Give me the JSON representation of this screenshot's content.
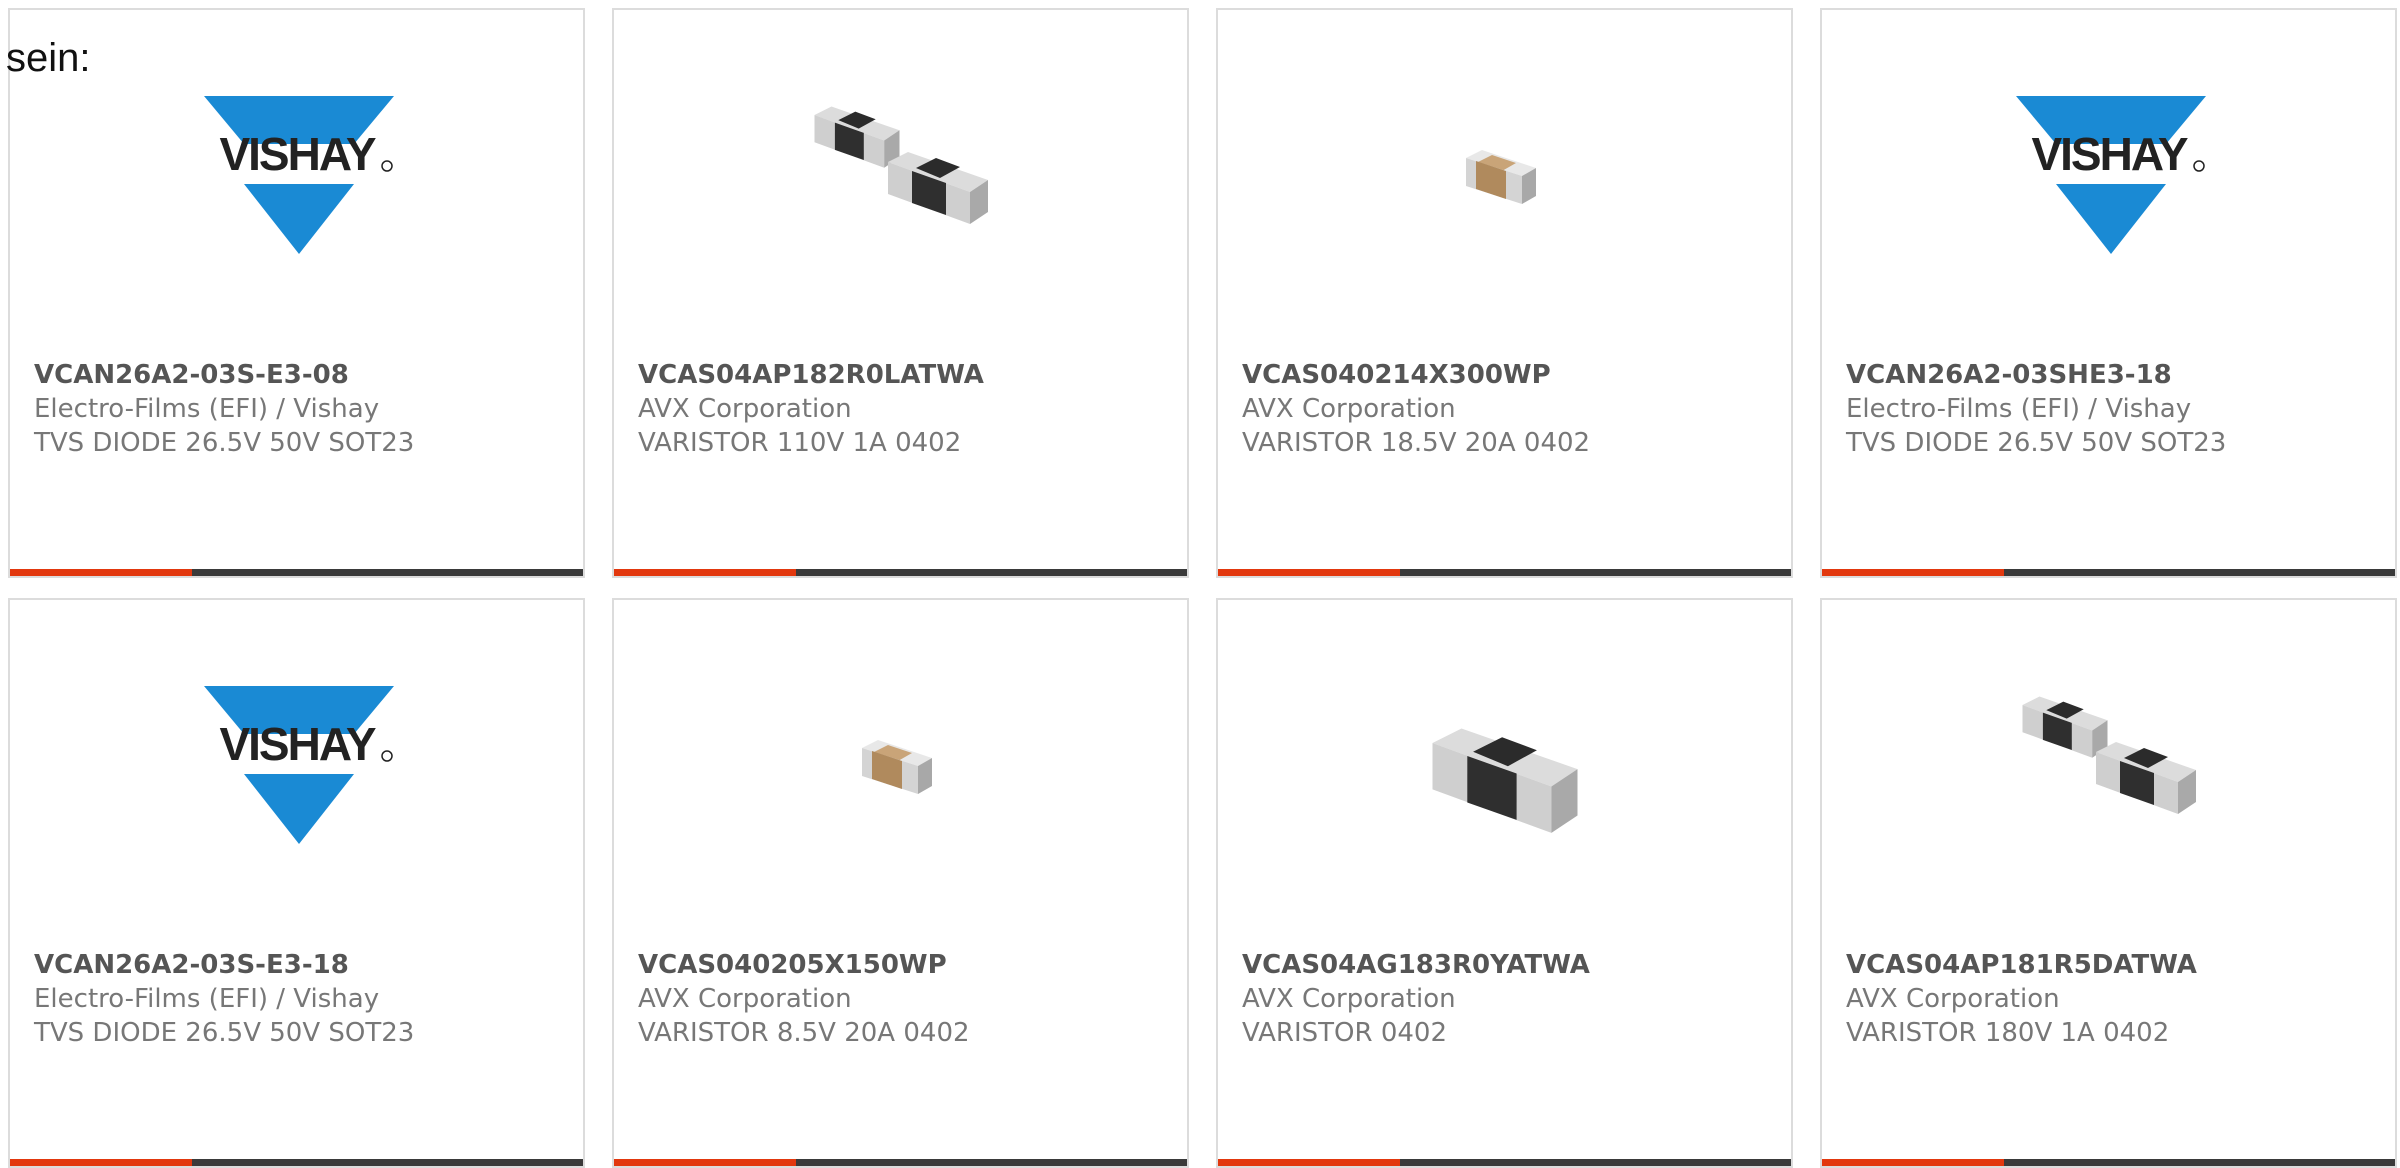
{
  "intro_text": "sein:",
  "colors": {
    "accent": "#e2380e",
    "bar": "#3a3a3a",
    "vishay_blue": "#1a8ad4"
  },
  "products": [
    {
      "part_number": "VCAN26A2-03S-E3-08",
      "manufacturer": "Electro-Films (EFI) / Vishay",
      "description": "TVS DIODE 26.5V 50V SOT23",
      "image": "vishay-logo"
    },
    {
      "part_number": "VCAS04AP182R0LATWA",
      "manufacturer": "AVX Corporation",
      "description": "VARISTOR 110V 1A 0402",
      "image": "two-dark-chip-components"
    },
    {
      "part_number": "VCAS040214X300WP",
      "manufacturer": "AVX Corporation",
      "description": "VARISTOR 18.5V 20A 0402",
      "image": "small-tan-chip-component"
    },
    {
      "part_number": "VCAN26A2-03SHE3-18",
      "manufacturer": "Electro-Films (EFI) / Vishay",
      "description": "TVS DIODE 26.5V 50V SOT23",
      "image": "vishay-logo"
    },
    {
      "part_number": "VCAN26A2-03S-E3-18",
      "manufacturer": "Electro-Films (EFI) / Vishay",
      "description": "TVS DIODE 26.5V 50V SOT23",
      "image": "vishay-logo"
    },
    {
      "part_number": "VCAS040205X150WP",
      "manufacturer": "AVX Corporation",
      "description": "VARISTOR 8.5V 20A 0402",
      "image": "small-tan-chip-component"
    },
    {
      "part_number": "VCAS04AG183R0YATWA",
      "manufacturer": "AVX Corporation",
      "description": "VARISTOR 0402",
      "image": "large-dark-chip-component"
    },
    {
      "part_number": "VCAS04AP181R5DATWA",
      "manufacturer": "AVX Corporation",
      "description": "VARISTOR 180V 1A 0402",
      "image": "two-dark-chip-components"
    }
  ]
}
